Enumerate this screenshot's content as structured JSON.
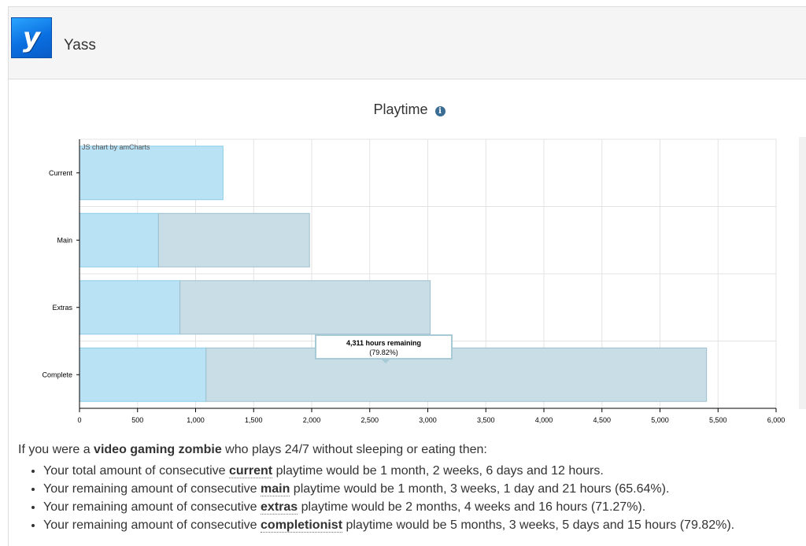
{
  "header": {
    "logo_letter": "y",
    "site_name": "Yass"
  },
  "chart": {
    "title": "Playtime",
    "info_icon": "info-circle-icon",
    "credit": "JS chart by amCharts",
    "tooltip": {
      "line1": "4,311 hours remaining",
      "line2": "(79.82%)"
    }
  },
  "chart_data": {
    "type": "bar",
    "orientation": "horizontal",
    "stacked": true,
    "categories": [
      "Current",
      "Main",
      "Extras",
      "Complete"
    ],
    "series": [
      {
        "values": [
          1236,
          680,
          865,
          1090
        ],
        "color": "#b9e2f5"
      },
      {
        "values": [
          0,
          1301,
          2156,
          4311
        ],
        "color": "#c9dde6"
      }
    ],
    "xlim": [
      0,
      6000
    ],
    "xticks": [
      0,
      500,
      1000,
      1500,
      2000,
      2500,
      3000,
      3500,
      4000,
      4500,
      5000,
      5500,
      6000
    ],
    "xtick_labels": [
      "0",
      "500",
      "1,000",
      "1,500",
      "2,000",
      "2,500",
      "3,000",
      "3,500",
      "4,000",
      "4,500",
      "5,000",
      "5,500",
      "6,000"
    ],
    "grid": true,
    "legend": "none"
  },
  "summary": {
    "intro_pre": "If you were a ",
    "intro_bold": "video gaming zombie",
    "intro_post": " who plays 24/7 without sleeping or eating then:",
    "items": [
      {
        "pre": "Your total amount of consecutive ",
        "kw": "current",
        "post": " playtime would be 1 month, 2 weeks, 6 days and 12 hours."
      },
      {
        "pre": "Your remaining amount of consecutive ",
        "kw": "main",
        "post": " playtime would be 1 month, 3 weeks, 1 day and 21 hours (65.64%)."
      },
      {
        "pre": "Your remaining amount of consecutive ",
        "kw": "extras",
        "post": " playtime would be 2 months, 4 weeks and 16 hours (71.27%)."
      },
      {
        "pre": "Your remaining amount of consecutive ",
        "kw": "completionist",
        "post": " playtime would be 5 months, 3 weeks, 5 days and 15 hours (79.82%)."
      }
    ]
  }
}
